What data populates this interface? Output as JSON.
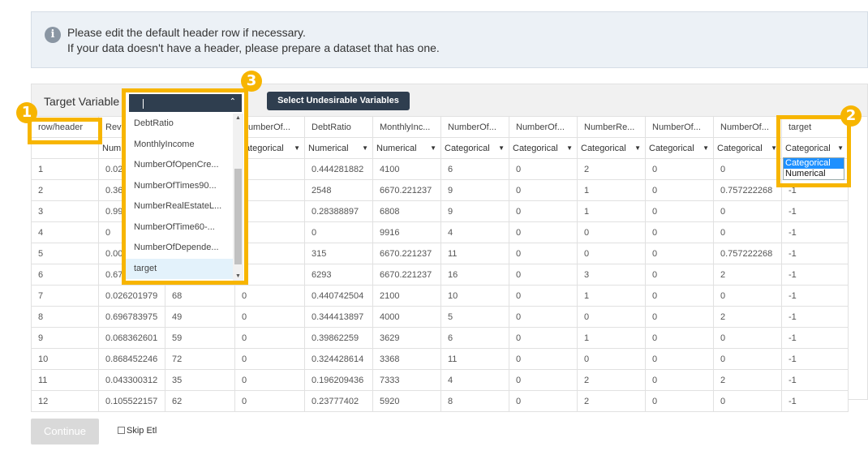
{
  "info": {
    "line1": "Please edit the default header row if necessary.",
    "line2": "If your data doesn't have a header, please prepare a dataset that has one."
  },
  "panel": {
    "title": "Target Variable",
    "select_button": "Select Undesirable Variables"
  },
  "table": {
    "row_header_label": "row/header",
    "headers": [
      "Rev",
      "",
      "NumberOf...",
      "DebtRatio",
      "MonthlyInc...",
      "NumberOf...",
      "NumberOf...",
      "NumberRe...",
      "NumberOf...",
      "NumberOf...",
      "target"
    ],
    "types": [
      "Num",
      "",
      "Categorical",
      "Numerical",
      "Numerical",
      "Categorical",
      "Categorical",
      "Categorical",
      "Categorical",
      "Categorical",
      "Categorical"
    ],
    "rows": [
      [
        "1",
        "0.02",
        "",
        "",
        "0.444281882",
        "4100",
        "6",
        "0",
        "2",
        "0",
        "0",
        ""
      ],
      [
        "2",
        "0.36",
        "",
        "",
        "2548",
        "6670.221237",
        "9",
        "0",
        "1",
        "0",
        "0.757222268",
        "-1"
      ],
      [
        "3",
        "0.99",
        "",
        "",
        "0.28388897",
        "6808",
        "9",
        "0",
        "1",
        "0",
        "0",
        "-1"
      ],
      [
        "4",
        "0",
        "",
        "",
        "0",
        "9916",
        "4",
        "0",
        "0",
        "0",
        "0",
        "-1"
      ],
      [
        "5",
        "0.00",
        "",
        "",
        "315",
        "6670.221237",
        "11",
        "0",
        "0",
        "0",
        "0.757222268",
        "-1"
      ],
      [
        "6",
        "0.67",
        "",
        "",
        "6293",
        "6670.221237",
        "16",
        "0",
        "3",
        "0",
        "2",
        "-1"
      ],
      [
        "7",
        "0.026201979",
        "68",
        "0",
        "0.440742504",
        "2100",
        "10",
        "0",
        "1",
        "0",
        "0",
        "-1"
      ],
      [
        "8",
        "0.696783975",
        "49",
        "0",
        "0.344413897",
        "4000",
        "5",
        "0",
        "0",
        "0",
        "2",
        "-1"
      ],
      [
        "9",
        "0.068362601",
        "59",
        "0",
        "0.39862259",
        "3629",
        "6",
        "0",
        "1",
        "0",
        "0",
        "-1"
      ],
      [
        "10",
        "0.868452246",
        "72",
        "0",
        "0.324428614",
        "3368",
        "11",
        "0",
        "0",
        "0",
        "0",
        "-1"
      ],
      [
        "11",
        "0.043300312",
        "35",
        "0",
        "0.196209436",
        "7333",
        "4",
        "0",
        "2",
        "0",
        "2",
        "-1"
      ],
      [
        "12",
        "0.105522157",
        "62",
        "0",
        "0.23777402",
        "5920",
        "8",
        "0",
        "2",
        "0",
        "0",
        "-1"
      ]
    ]
  },
  "dropdown": {
    "items": [
      "DebtRatio",
      "MonthlyIncome",
      "NumberOfOpenCre...",
      "NumberOfTimes90...",
      "NumberRealEstateL...",
      "NumberOfTime60-...",
      "NumberOfDepende...",
      "target"
    ],
    "selected": "target"
  },
  "target_popup": {
    "options": [
      "Categorical",
      "Numerical"
    ],
    "selected": "Categorical"
  },
  "badges": [
    "1",
    "2",
    "3"
  ],
  "footer": {
    "continue": "Continue",
    "skip": "Skip Etl"
  },
  "colors": {
    "highlight": "#f7b500",
    "button_dark": "#2f3e4f",
    "selected_option": "#1e90ff"
  }
}
